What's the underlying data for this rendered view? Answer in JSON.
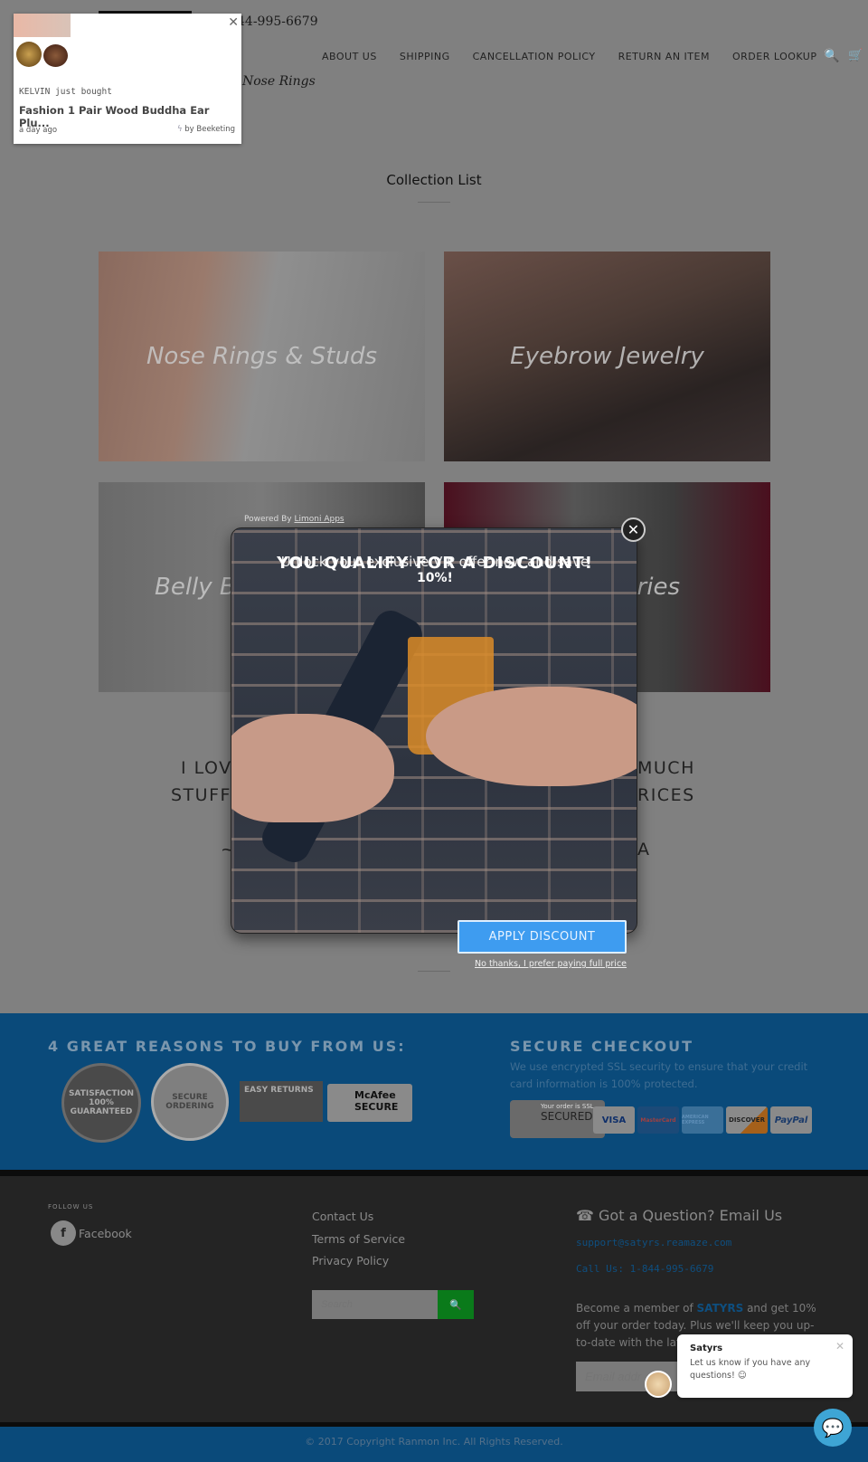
{
  "header": {
    "phone": "44-995-6679",
    "tagline": "Nose Rings",
    "nav": [
      "ABOUT US",
      "SHIPPING",
      "CANCELLATION POLICY",
      "RETURN AN ITEM",
      "ORDER LOOKUP"
    ]
  },
  "collection": {
    "title": "Collection List",
    "tiles": [
      "Nose Rings & Studs",
      "Eyebrow Jewelry",
      "Belly B",
      "ries"
    ]
  },
  "testimonial": {
    "line1_left": "I LOV",
    "line1_right": "MUCH",
    "line2_left": "STUFF",
    "line2_right": "RICES",
    "line3_left": "~",
    "line3_right": "A"
  },
  "reasons": {
    "title": "4 GREAT REASONS TO BUY FROM US:",
    "badges": [
      "SATISFACTION 100% GUARANTEED",
      "SECURE ORDERING",
      "EASY RETURNS",
      "McAfee SECURE"
    ]
  },
  "secure": {
    "title": "SECURE CHECKOUT",
    "text": "We use encrypted SSL security to ensure that your credit card information is 100% protected.",
    "ssl": "Your order is SSL",
    "ssl2": "SECURED",
    "cards": [
      "VISA",
      "MasterCard",
      "AMERICAN EXPRESS",
      "DISCOVER",
      "PayPal"
    ]
  },
  "footer": {
    "follow": "FOLLOW US",
    "facebook": "Facebook",
    "links": [
      "Contact Us",
      "Terms of Service",
      "Privacy Policy"
    ],
    "search_placeholder": "Search",
    "question": "Got a Question? Email Us",
    "email": "support@satyrs.reamaze.com",
    "call": "Call Us: 1-844-995-6679",
    "member_pre": "Become a member of ",
    "member_brand": "SATYRS",
    "member_post": " and get 10% off your order today. Plus we'll keep you up-to-date with the lat",
    "email_placeholder": "Email addr",
    "copyright": "© 2017 Copyright Ranmon Inc. All Rights Reserved."
  },
  "popup": {
    "buyer": "KELVIN just bought",
    "product": "Fashion 1 Pair Wood Buddha Ear Plu...",
    "time": "a day ago",
    "by": "by Beeketing"
  },
  "modal": {
    "powered_pre": "Powered By ",
    "powered_link": "Limoni Apps",
    "headline": "YOU QUALIFY FOR A DISCOUNT!",
    "subline": "Unlock your exclusive VIP offer now and save",
    "subline2": "10%!",
    "apply": "APPLY DISCOUNT",
    "decline": "No thanks, I prefer paying full price"
  },
  "chat": {
    "name": "Satyrs",
    "message": "Let us know if you have any questions! ☺"
  },
  "colors": {
    "band": "#0a4a7a",
    "footer": "#242424",
    "apply": "#3e9cf0",
    "search_btn": "#0a7a1a",
    "link": "#0e4f80"
  }
}
